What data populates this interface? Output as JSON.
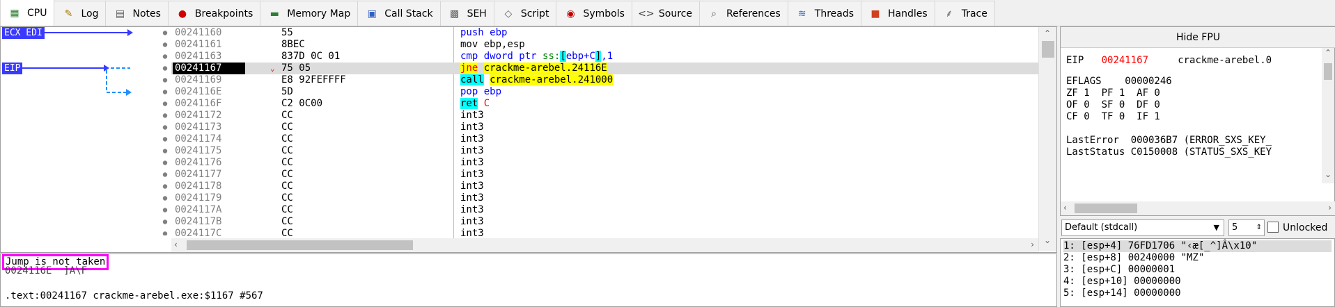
{
  "tabs": [
    {
      "label": "CPU",
      "icon": "cpu-icon",
      "glyph": "▦",
      "color": "#2e7d32",
      "active": true
    },
    {
      "label": "Log",
      "icon": "log-icon",
      "glyph": "✎",
      "color": "#b07a00"
    },
    {
      "label": "Notes",
      "icon": "notes-icon",
      "glyph": "▤",
      "color": "#606060"
    },
    {
      "label": "Breakpoints",
      "icon": "breakpoints-icon",
      "glyph": "●",
      "color": "#d00000"
    },
    {
      "label": "Memory Map",
      "icon": "memory-map-icon",
      "glyph": "▬",
      "color": "#2e7d32"
    },
    {
      "label": "Call Stack",
      "icon": "call-stack-icon",
      "glyph": "▣",
      "color": "#3060c0"
    },
    {
      "label": "SEH",
      "icon": "seh-icon",
      "glyph": "▩",
      "color": "#606060"
    },
    {
      "label": "Script",
      "icon": "script-icon",
      "glyph": "◇",
      "color": "#606060"
    },
    {
      "label": "Symbols",
      "icon": "symbols-icon",
      "glyph": "◉",
      "color": "#c00000"
    },
    {
      "label": "Source",
      "icon": "source-icon",
      "glyph": "<>",
      "color": "#404040"
    },
    {
      "label": "References",
      "icon": "references-icon",
      "glyph": "⌕",
      "color": "#606060"
    },
    {
      "label": "Threads",
      "icon": "threads-icon",
      "glyph": "≋",
      "color": "#3070d0"
    },
    {
      "label": "Handles",
      "icon": "handles-icon",
      "glyph": "■",
      "color": "#d04020"
    },
    {
      "label": "Trace",
      "icon": "trace-icon",
      "glyph": "⸙",
      "color": "#606060"
    }
  ],
  "labels": {
    "ecx_edi": "ECX EDI",
    "eip": "EIP"
  },
  "disasm": [
    {
      "addr": "00241160",
      "bytes": "55",
      "instr": "push ebp"
    },
    {
      "addr": "00241161",
      "bytes": "8BEC",
      "instr": "mov ebp,esp"
    },
    {
      "addr": "00241163",
      "bytes": "837D 0C 01",
      "instr": "cmp dword ptr ss:[ebp+C],1"
    },
    {
      "addr": "00241167",
      "bytes": "75 05",
      "instr": "jne crackme-arebel.24116E",
      "current": true
    },
    {
      "addr": "00241169",
      "bytes": "E8 92FEFFFF",
      "instr": "call crackme-arebel.241000"
    },
    {
      "addr": "0024116E",
      "bytes": "5D",
      "instr": "pop ebp"
    },
    {
      "addr": "0024116F",
      "bytes": "C2 0C00",
      "instr": "ret C"
    },
    {
      "addr": "00241172",
      "bytes": "CC",
      "instr": "int3"
    },
    {
      "addr": "00241173",
      "bytes": "CC",
      "instr": "int3"
    },
    {
      "addr": "00241174",
      "bytes": "CC",
      "instr": "int3"
    },
    {
      "addr": "00241175",
      "bytes": "CC",
      "instr": "int3"
    },
    {
      "addr": "00241176",
      "bytes": "CC",
      "instr": "int3"
    },
    {
      "addr": "00241177",
      "bytes": "CC",
      "instr": "int3"
    },
    {
      "addr": "00241178",
      "bytes": "CC",
      "instr": "int3"
    },
    {
      "addr": "00241179",
      "bytes": "CC",
      "instr": "int3"
    },
    {
      "addr": "0024117A",
      "bytes": "CC",
      "instr": "int3"
    },
    {
      "addr": "0024117B",
      "bytes": "CC",
      "instr": "int3"
    },
    {
      "addr": "0024117C",
      "bytes": "CC",
      "instr": "int3"
    }
  ],
  "info": {
    "jump_status": "Jump is not taken",
    "target_line": "0024116E  ]A\\F",
    "location": ".text:00241167 crackme-arebel.exe:$1167 #567"
  },
  "registers": {
    "hide_fpu": "Hide FPU",
    "eip_name": "EIP",
    "eip_value": "00241167",
    "eip_label": "crackme-arebel.0",
    "eflags": "EFLAGS    00000246",
    "flags_row1": "ZF 1  PF 1  AF 0",
    "flags_row2": "OF 0  SF 0  DF 0",
    "flags_row3": "CF 0  TF 0  IF 1",
    "last_error": "LastError  000036B7 (ERROR_SXS_KEY_",
    "last_status": "LastStatus C0150008 (STATUS_SXS_KEY"
  },
  "callconv": {
    "selected": "Default (stdcall)",
    "count": "5",
    "unlocked_label": "Unlocked"
  },
  "stack": [
    "1: [esp+4] 76FD1706 \"‹æ[_^]Â\\x10\"",
    "2: [esp+8] 00240000 \"MZ\"",
    "3: [esp+C] 00000001",
    "4: [esp+10] 00000000",
    "5: [esp+14] 00000000"
  ],
  "colors": {
    "accent_label": "#3a3aff",
    "jump_highlight": "#ff00ff",
    "branch_arrow": "#1e90ff"
  }
}
